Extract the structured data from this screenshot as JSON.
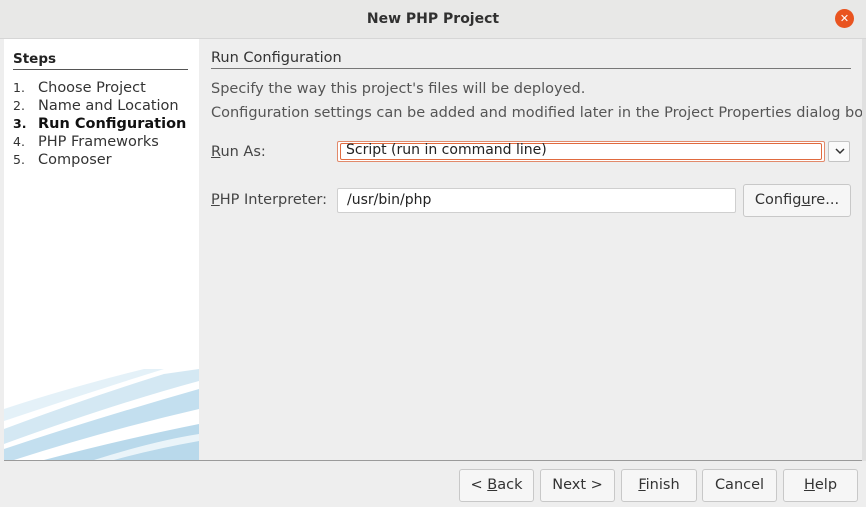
{
  "window": {
    "title": "New PHP Project"
  },
  "steps": {
    "title": "Steps",
    "items": [
      {
        "num": "1.",
        "label": "Choose Project",
        "current": false
      },
      {
        "num": "2.",
        "label": "Name and Location",
        "current": false
      },
      {
        "num": "3.",
        "label": "Run Configuration",
        "current": true
      },
      {
        "num": "4.",
        "label": "PHP Frameworks",
        "current": false
      },
      {
        "num": "5.",
        "label": "Composer",
        "current": false
      }
    ]
  },
  "content": {
    "title": "Run Configuration",
    "description_line1": "Specify the way this project's files will be deployed.",
    "description_line2": "Configuration settings can be added and modified later in the Project Properties dialog box.",
    "run_as": {
      "label_mnemonic": "R",
      "label_rest": "un As:",
      "value": "Script (run in command line)"
    },
    "php_interpreter": {
      "label_mnemonic": "P",
      "label_rest": "HP Interpreter:",
      "value": "/usr/bin/php"
    },
    "configure_button": {
      "pre": "Config",
      "mnemonic": "u",
      "post": "re..."
    }
  },
  "buttons": {
    "back": {
      "pre": "< ",
      "mnemonic": "B",
      "post": "ack"
    },
    "next": {
      "pre": "Next >",
      "mnemonic": "",
      "post": ""
    },
    "finish": {
      "pre": "",
      "mnemonic": "F",
      "post": "inish"
    },
    "cancel": {
      "pre": "Cancel",
      "mnemonic": "",
      "post": ""
    },
    "help": {
      "pre": "",
      "mnemonic": "H",
      "post": "elp"
    }
  },
  "colors": {
    "accent": "#e95420",
    "focus_border": "#e06a3f",
    "swoosh": "#b8d9ec"
  },
  "icons": {
    "close": "close-icon",
    "dropdown": "chevron-down-icon"
  }
}
